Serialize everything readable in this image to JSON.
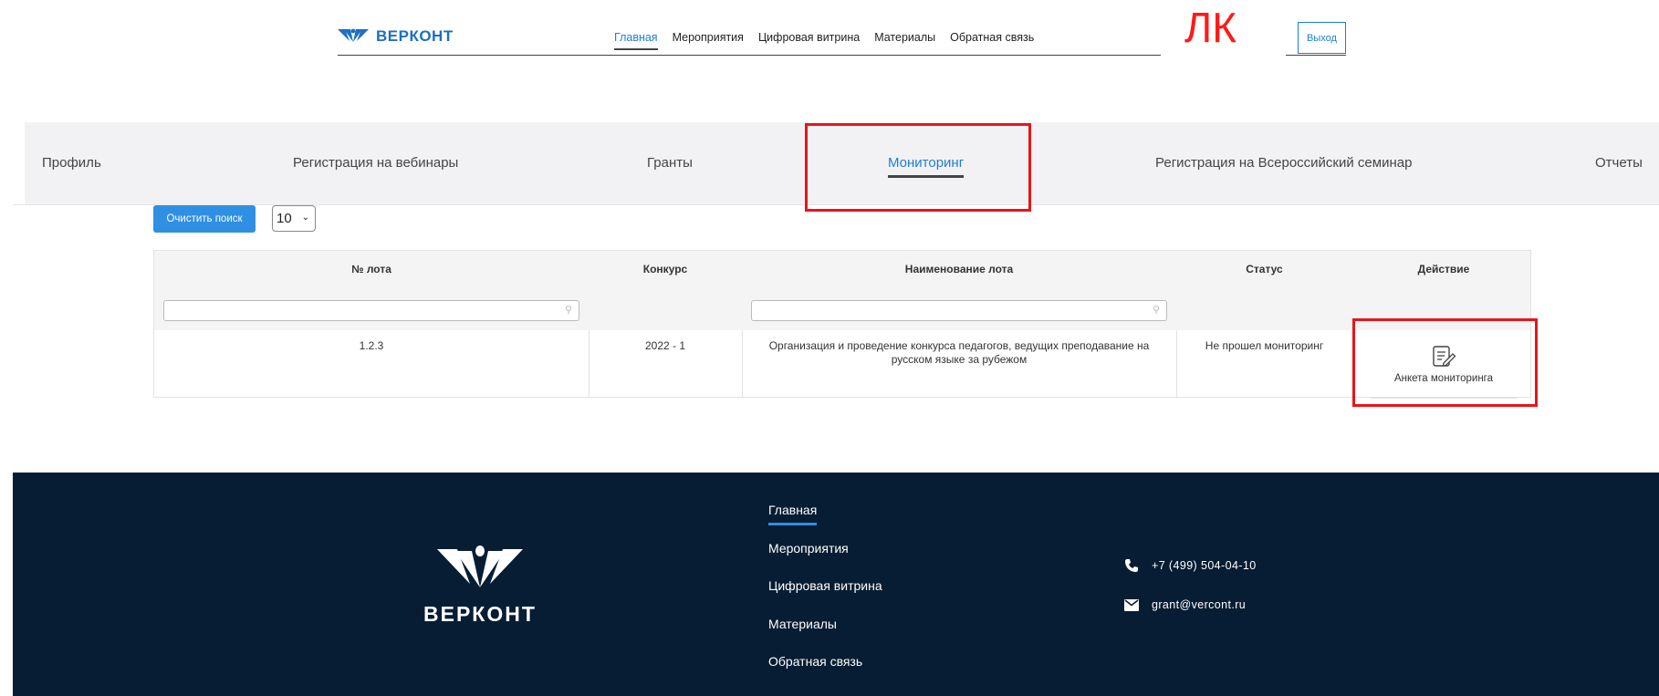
{
  "header": {
    "logo_text": "ВЕРКОНТ",
    "nav": [
      "Главная",
      "Мероприятия",
      "Цифровая витрина",
      "Материалы",
      "Обратная связь"
    ],
    "active_nav": "Главная",
    "annotation": "ЛК",
    "logout_label": "Выход"
  },
  "tabs": {
    "items": [
      "Профиль",
      "Регистрация на вебинары",
      "Гранты",
      "Мониторинг",
      "Регистрация на Всероссийский семинар",
      "Отчеты"
    ],
    "active": "Мониторинг"
  },
  "controls": {
    "clear_label": "Очистить поиск",
    "page_size": "10"
  },
  "table": {
    "headers": [
      "№ лота",
      "Конкурс",
      "Наименование лота",
      "Статус",
      "Действие"
    ],
    "rows": [
      {
        "lot": "1.2.3",
        "contest": "2022 - 1",
        "name": "Организация и проведение конкурса педагогов, ведущих преподавание на русском языке за рубежом",
        "status": "Не прошел мониторинг",
        "action": "Анкета мониторинга"
      }
    ]
  },
  "footer": {
    "logo_text": "ВЕРКОНТ",
    "nav": [
      "Главная",
      "Мероприятия",
      "Цифровая витрина",
      "Материалы",
      "Обратная связь"
    ],
    "phone": "+7 (499) 504-04-10",
    "email": "grant@vercont.ru"
  },
  "colors": {
    "accent": "#1c7fd6",
    "button": "#2f8fe3",
    "highlight": "#e8141a",
    "footer_bg": "#061d33",
    "tabbar_bg": "#f2f2f4"
  },
  "icons": [
    "logo-icon",
    "edit-form-icon",
    "search-icon",
    "chevron-down-icon",
    "phone-icon",
    "mail-icon",
    "footer-logo-icon"
  ]
}
